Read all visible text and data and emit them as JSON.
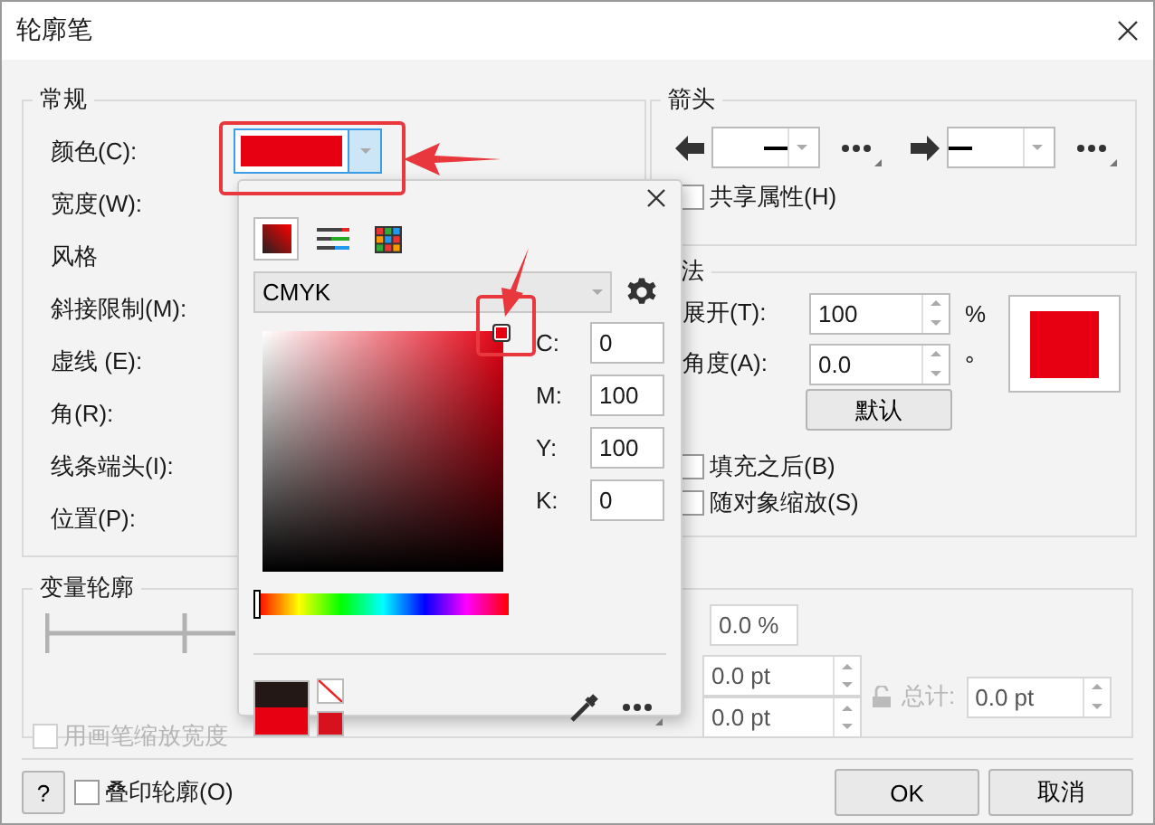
{
  "window": {
    "title": "轮廓笔"
  },
  "general": {
    "title": "常规",
    "labels": [
      "颜色(C):",
      "宽度(W):",
      "风格",
      "斜接限制(M):",
      "虚线 (E):",
      "角(R):",
      "线条端头(I):",
      "位置(P):"
    ]
  },
  "arrows": {
    "title": "箭头",
    "share": {
      "label": "共享属性(H)",
      "checked": false
    }
  },
  "calligraphy": {
    "title": "法",
    "stretch": {
      "label": "展开(T):",
      "value": "100",
      "unit": "%"
    },
    "angle": {
      "label": "角度(A):",
      "value": "0.0",
      "unit": "°"
    },
    "default_button": "默认",
    "options": [
      {
        "label": "填充之后(B)",
        "checked": false
      },
      {
        "label": "随对象缩放(S)",
        "checked": false
      }
    ]
  },
  "variable": {
    "title": "变量轮廓",
    "percent": "0.0 %",
    "widths": [
      "0.0 pt",
      "0.0 pt"
    ],
    "total_label": "总计:",
    "total": "0.0 pt",
    "scale_width": {
      "label": "用画笔缩放宽度",
      "checked": false,
      "disabled": true
    }
  },
  "color_popup": {
    "modes": [
      {
        "kind": "mixer",
        "selected": true
      },
      {
        "kind": "sliders",
        "selected": false
      },
      {
        "kind": "palette",
        "selected": false
      }
    ],
    "model": "CMYK",
    "channels": [
      {
        "label": "C:",
        "value": "0"
      },
      {
        "label": "M:",
        "value": "100"
      },
      {
        "label": "Y:",
        "value": "100"
      },
      {
        "label": "K:",
        "value": "0"
      }
    ],
    "hue": {
      "level": 0
    }
  },
  "footer": {
    "help": "?",
    "overprint": {
      "label": "叠印轮廓(O)",
      "checked": false
    },
    "buttons": [
      "OK",
      "取消"
    ]
  }
}
